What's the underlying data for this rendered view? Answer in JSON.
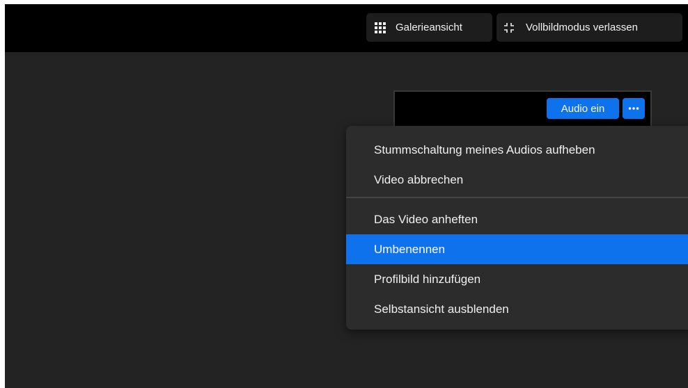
{
  "toolbar": {
    "gallery_label": "Galerieansicht",
    "exit_fullscreen_label": "Vollbildmodus verlassen"
  },
  "video_tile": {
    "audio_button_label": "Audio ein",
    "more_button_label": "···"
  },
  "context_menu": {
    "items": [
      {
        "label": "Stummschaltung meines Audios aufheben"
      },
      {
        "label": "Video abbrechen"
      },
      {
        "label": "Das Video anheften"
      },
      {
        "label": "Umbenennen",
        "highlighted": true
      },
      {
        "label": "Profilbild hinzufügen"
      },
      {
        "label": "Selbstansicht ausblenden"
      }
    ]
  },
  "colors": {
    "accent": "#0e72ed",
    "background": "#232323",
    "topbar": "#000000",
    "menu": "#2c2c2c"
  },
  "icons": {
    "gallery": "grid-icon",
    "exit_fullscreen": "collapse-icon",
    "more": "ellipsis-icon"
  }
}
